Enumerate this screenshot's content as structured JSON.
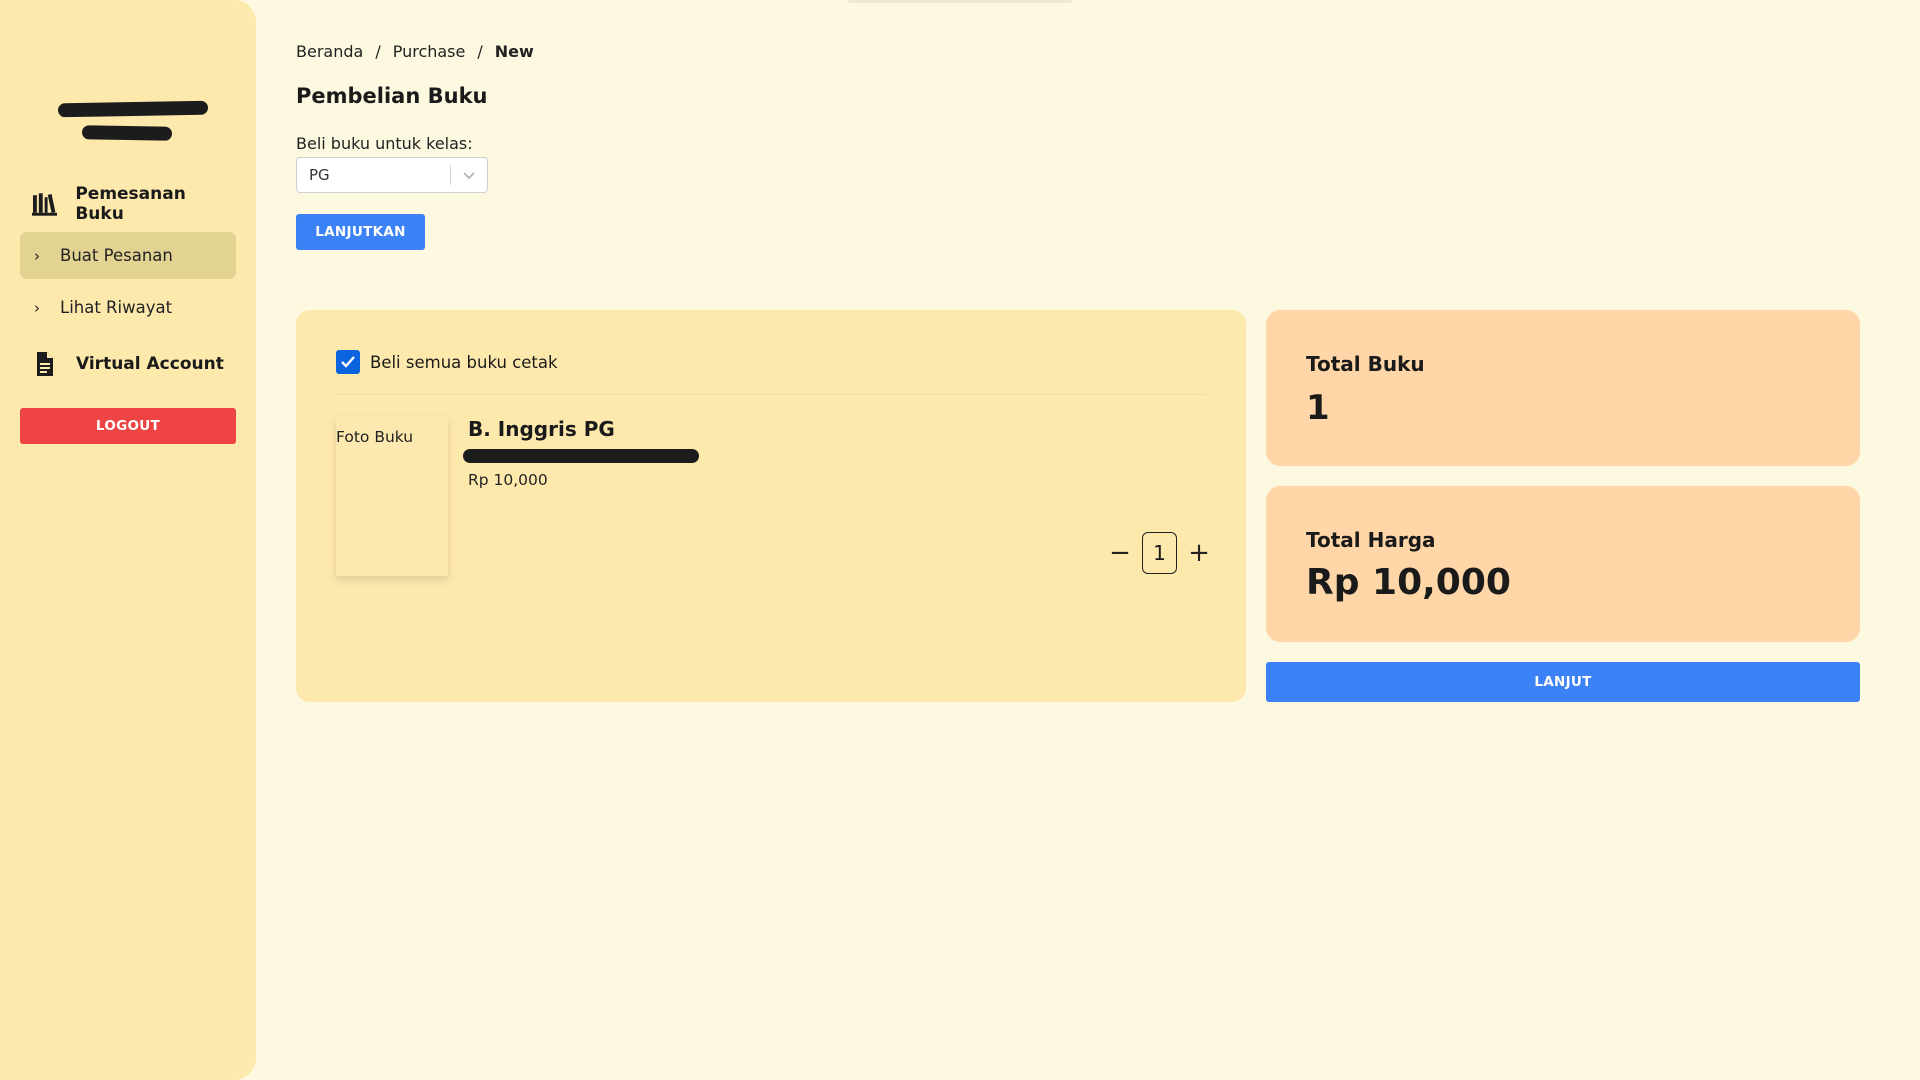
{
  "sidebar": {
    "section1": "Pemesanan Buku",
    "items": [
      {
        "label": "Buat Pesanan",
        "active": true
      },
      {
        "label": "Lihat Riwayat",
        "active": false
      }
    ],
    "section2": "Virtual Account",
    "logout": "LOGOUT"
  },
  "breadcrumb": [
    "Beranda",
    "/",
    "Purchase",
    "/",
    "New"
  ],
  "page": {
    "title": "Pembelian Buku",
    "class_label": "Beli buku untuk kelas:",
    "class_value": "PG",
    "continue": "LANJUTKAN"
  },
  "cart": {
    "select_all": "Beli semua buku cetak",
    "select_all_checked": true,
    "items": [
      {
        "photo": "Foto Buku",
        "name": "B. Inggris PG",
        "price": "Rp 10,000",
        "qty": "1"
      }
    ]
  },
  "summary": {
    "total_books_label": "Total Buku",
    "total_books": "1",
    "total_price_label": "Total Harga",
    "total_price": "Rp 10,000",
    "next": "LANJUT"
  },
  "colors": {
    "accent": "#3b82f6",
    "danger": "#ef4444",
    "sidebar": "#fee9ad",
    "summary": "#fed6a8"
  }
}
